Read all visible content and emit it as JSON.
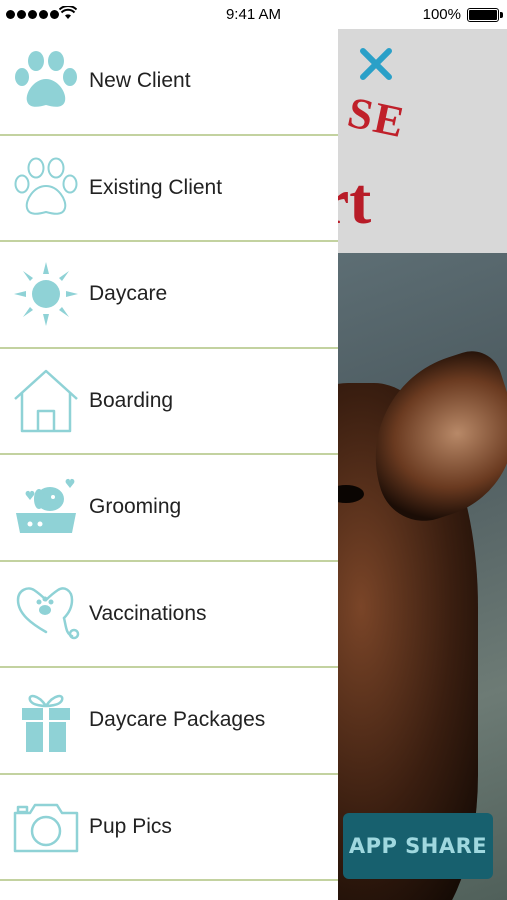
{
  "status_bar": {
    "time": "9:41 AM",
    "battery": "100%"
  },
  "menu": {
    "items": [
      {
        "label": "New Client",
        "icon": "paw-filled-icon"
      },
      {
        "label": "Existing Client",
        "icon": "paw-outline-icon"
      },
      {
        "label": "Daycare",
        "icon": "sun-icon"
      },
      {
        "label": "Boarding",
        "icon": "house-icon"
      },
      {
        "label": "Grooming",
        "icon": "grooming-dog-icon"
      },
      {
        "label": "Vaccinations",
        "icon": "stethoscope-paw-icon"
      },
      {
        "label": "Daycare Packages",
        "icon": "gift-icon"
      },
      {
        "label": "Pup Pics",
        "icon": "camera-icon"
      }
    ]
  },
  "background": {
    "logo_fragment_top": "SE",
    "logo_fragment_bottom": "rt",
    "share_button_label": "APP SHARE"
  },
  "colors": {
    "icon_teal": "#8fd2d6",
    "divider": "#c3d2a0",
    "close_blue": "#2aa0c8",
    "share_bg": "#17606e"
  }
}
